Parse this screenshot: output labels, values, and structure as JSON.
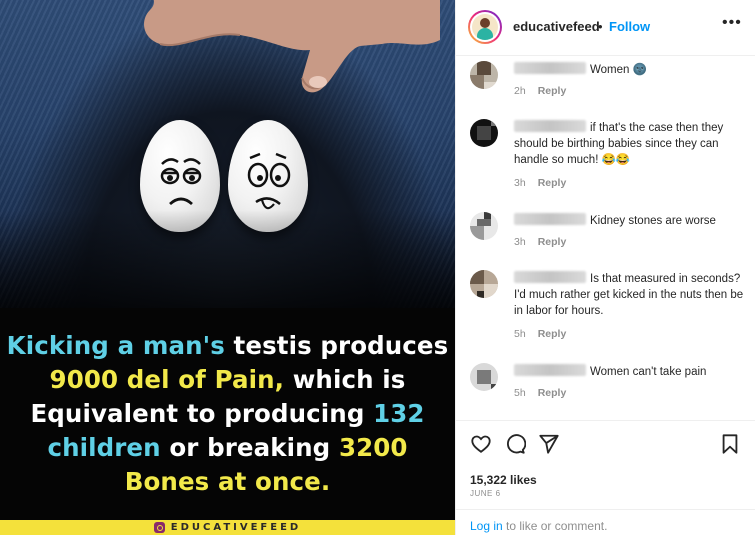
{
  "post": {
    "caption_lines": [
      [
        {
          "t": "Kicking a man's ",
          "c": "cyan"
        },
        {
          "t": "testis produces",
          "c": "white"
        }
      ],
      [
        {
          "t": "9000 del of Pain, ",
          "c": "yellow"
        },
        {
          "t": "which is",
          "c": "white"
        }
      ],
      [
        {
          "t": "Equivalent to producing ",
          "c": "white"
        },
        {
          "t": "132",
          "c": "cyan"
        }
      ],
      [
        {
          "t": "children ",
          "c": "cyan"
        },
        {
          "t": "or breaking ",
          "c": "white"
        },
        {
          "t": "3200",
          "c": "yellow"
        }
      ],
      [
        {
          "t": "Bones at once.",
          "c": "yellow"
        }
      ]
    ],
    "brand_text": "EDUCATIVEFEED"
  },
  "header": {
    "username": "educativefeed",
    "separator": "•",
    "follow_label": "Follow",
    "more_label": "•••"
  },
  "comments": [
    {
      "text": "Women 🌚",
      "time": "2h",
      "reply": "Reply"
    },
    {
      "text": "if that's the case then they should be birthing babies since they can handle so much! 😂😂",
      "time": "3h",
      "reply": "Reply"
    },
    {
      "text": "Kidney stones are worse",
      "time": "3h",
      "reply": "Reply"
    },
    {
      "text": "Is that measured in seconds? I'd much rather get kicked in the nuts then be in labor for hours.",
      "time": "5h",
      "reply": "Reply"
    },
    {
      "text": "Women can't take pain",
      "time": "5h",
      "reply": "Reply"
    }
  ],
  "actions": {
    "likes": "15,322 likes",
    "date": "JUNE 6",
    "login_link": "Log in",
    "login_rest": " to like or comment."
  },
  "colors": {
    "cyan": "#5fd0e6",
    "yellow": "#f2e94a",
    "link": "#0095f6",
    "muted": "#8e8e8e"
  }
}
